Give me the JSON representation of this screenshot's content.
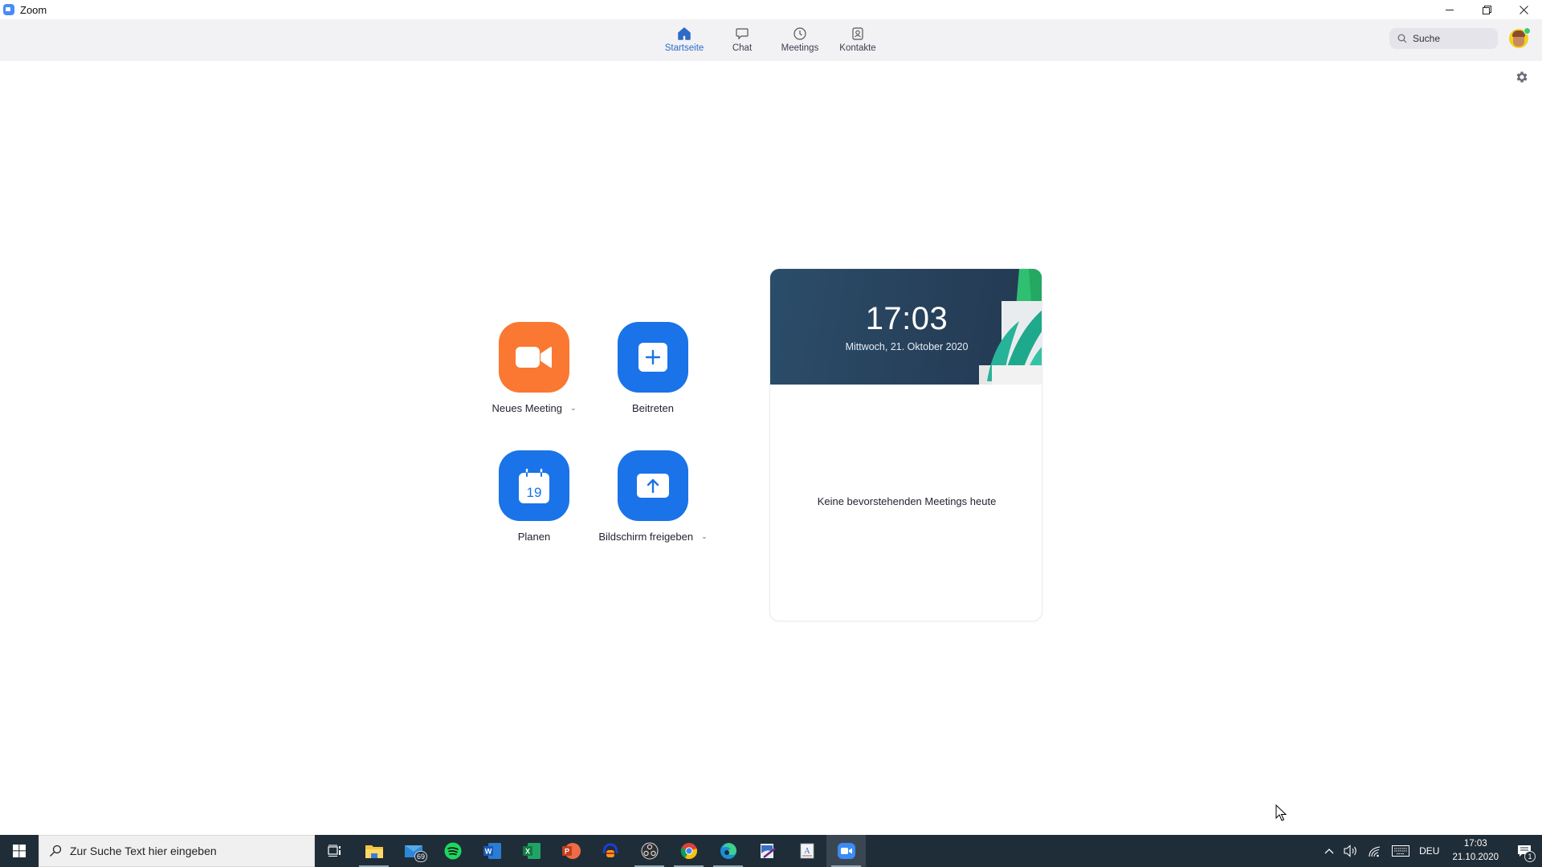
{
  "window": {
    "title": "Zoom",
    "controls": {
      "minimize": "—",
      "restore": "❐",
      "close": "✕"
    }
  },
  "nav": {
    "tabs": [
      {
        "label": "Startseite",
        "icon": "home-icon",
        "active": true
      },
      {
        "label": "Chat",
        "icon": "chat-icon",
        "active": false
      },
      {
        "label": "Meetings",
        "icon": "clock-icon",
        "active": false
      },
      {
        "label": "Kontakte",
        "icon": "contact-icon",
        "active": false
      }
    ],
    "search_label": "Suche",
    "accent_color": "#2d6bc7"
  },
  "actions": [
    {
      "label": "Neues Meeting",
      "icon": "video-camera-icon",
      "color": "#fa7831",
      "has_dropdown": true
    },
    {
      "label": "Beitreten",
      "icon": "plus-icon",
      "color": "#1a73e8",
      "has_dropdown": false
    },
    {
      "label": "Planen",
      "icon": "calendar-icon",
      "calendar_day": "19",
      "color": "#1a73e8",
      "has_dropdown": false
    },
    {
      "label": "Bildschirm freigeben",
      "icon": "share-screen-icon",
      "color": "#1a73e8",
      "has_dropdown": true
    }
  ],
  "card": {
    "time": "17:03",
    "date": "Mittwoch, 21. Oktober 2020",
    "empty_message": "Keine bevorstehenden Meetings heute"
  },
  "taskbar": {
    "search_placeholder": "Zur Suche Text hier eingeben",
    "apps": [
      {
        "name": "task-view",
        "icon": "task-view-icon"
      },
      {
        "name": "file-explorer",
        "icon": "folder-icon"
      },
      {
        "name": "mail",
        "icon": "mail-icon",
        "badge": "69"
      },
      {
        "name": "spotify",
        "icon": "spotify-icon"
      },
      {
        "name": "word",
        "icon": "word-icon"
      },
      {
        "name": "excel",
        "icon": "excel-icon"
      },
      {
        "name": "powerpoint",
        "icon": "powerpoint-icon"
      },
      {
        "name": "audacity",
        "icon": "audacity-icon"
      },
      {
        "name": "obs",
        "icon": "obs-icon"
      },
      {
        "name": "chrome",
        "icon": "chrome-icon"
      },
      {
        "name": "edge",
        "icon": "edge-icon"
      },
      {
        "name": "paint-app",
        "icon": "paint-icon"
      },
      {
        "name": "wordpad",
        "icon": "wordpad-icon"
      },
      {
        "name": "zoom",
        "icon": "zoom-icon",
        "active": true
      }
    ],
    "tray": {
      "language": "DEU",
      "time": "17:03",
      "date": "21.10.2020",
      "notification_count": "1"
    }
  }
}
